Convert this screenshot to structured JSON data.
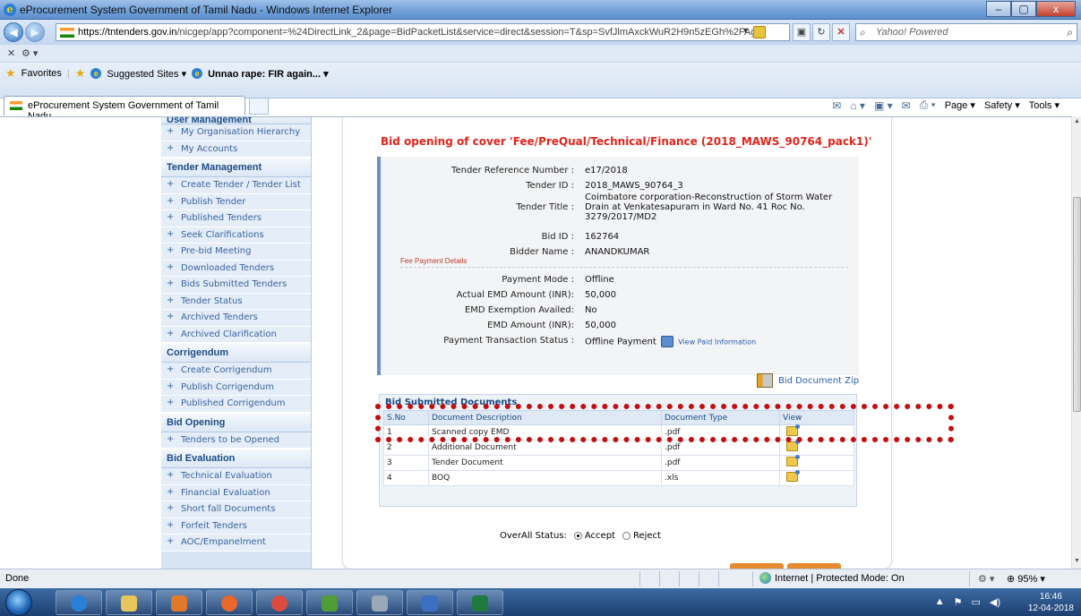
{
  "window": {
    "title": "eProcurement System Government of Tamil Nadu - Windows Internet Explorer",
    "buttons": [
      "–",
      "▢",
      "x"
    ]
  },
  "browser": {
    "url_domain": "https://tntenders.gov.in",
    "url_path": "/nicgep/app?component=%24DirectLink_2&page=BidPacketList&service=direct&session=T&sp=SvfJlmAxckWuR2H9n5zEGh%2FAg",
    "search_placeholder": "Yahoo! Powered",
    "favorites_label": "Favorites",
    "suggested_sites": "Suggested Sites ▾",
    "unnao_link": "Unnao rape: FIR again... ▾",
    "tab_title": "eProcurement System Government of Tamil Nadu",
    "cmd_page": "Page ▾",
    "cmd_safety": "Safety ▾",
    "cmd_tools": "Tools ▾"
  },
  "menu": {
    "sections": [
      {
        "title": "User Management",
        "items": [
          "My Organisation Hierarchy",
          "My Accounts"
        ]
      },
      {
        "title": "Tender Management",
        "items": [
          "Create Tender / Tender List",
          "Publish Tender",
          "Published Tenders",
          "Seek Clarifications",
          "Pre-bid Meeting",
          "Downloaded Tenders",
          "Bids Submitted Tenders",
          "Tender Status",
          "Archived Tenders",
          "Archived Clarification"
        ]
      },
      {
        "title": "Corrigendum",
        "items": [
          "Create Corrigendum",
          "Publish Corrigendum",
          "Published Corrigendum"
        ]
      },
      {
        "title": "Bid Opening",
        "items": [
          "Tenders to be Opened"
        ]
      },
      {
        "title": "Bid Evaluation",
        "items": [
          "Technical Evaluation",
          "Financial Evaluation",
          "Short fall Documents",
          "Forfeit Tenders",
          "AOC/Empanelment"
        ]
      }
    ]
  },
  "main": {
    "title": "Bid opening of cover 'Fee/PreQual/Technical/Finance (2018_MAWS_90764_pack1)'",
    "details": {
      "tender_ref_label": "Tender Reference Number :",
      "tender_ref": "e17/2018",
      "tender_id_label": "Tender ID :",
      "tender_id": "2018_MAWS_90764_3",
      "tender_title_label": "Tender Title :",
      "tender_title": "Coimbatore corporation-Reconstruction of Storm Water Drain at Venkatesapuram in Ward No. 41 Roc No. 3279/2017/MD2",
      "bid_id_label": "Bid ID :",
      "bid_id": "162764",
      "bidder_label": "Bidder Name :",
      "bidder": "ANANDKUMAR"
    },
    "fee_heading": "Fee Payment Details",
    "fee": {
      "mode_label": "Payment Mode :",
      "mode": "Offline",
      "actual_emd_label": "Actual EMD Amount (INR):",
      "actual_emd": "50,000",
      "exemption_label": "EMD Exemption Availed:",
      "exemption": "No",
      "emd_label": "EMD Amount (INR):",
      "emd": "50,000",
      "txn_label": "Payment Transaction Status :",
      "txn": "Offline Payment",
      "view_paid": "View Paid Information"
    },
    "zip_label": "Bid Document Zip",
    "docs_title": "Bid Submitted Documents",
    "docs_headers": [
      "S.No",
      "Document Description",
      "Document Type",
      "View"
    ],
    "docs": [
      {
        "sno": "1",
        "desc": "Scanned copy EMD",
        "type": ".pdf"
      },
      {
        "sno": "2",
        "desc": "Additional Document",
        "type": ".pdf"
      },
      {
        "sno": "3",
        "desc": "Tender Document",
        "type": ".pdf"
      },
      {
        "sno": "4",
        "desc": "BOQ",
        "type": ".xls"
      }
    ],
    "overall_status_label": "OverAll Status:",
    "accept": "Accept",
    "reject": "Reject"
  },
  "statusbar": {
    "left": "Done",
    "zone": "Internet | Protected Mode: On",
    "zoom": "95%"
  },
  "taskbar": {
    "time": "16:46",
    "date": "12-04-2018"
  },
  "colors": {
    "accent_red": "#e0241b",
    "menu_blue": "#1b4a86"
  }
}
